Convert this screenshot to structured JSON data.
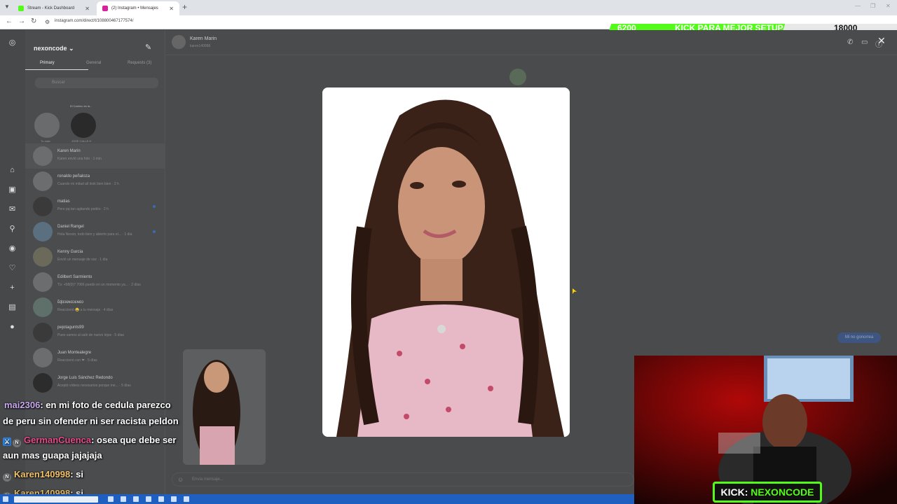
{
  "browser": {
    "tabs": [
      {
        "label": "Stream - Kick Dashboard",
        "favicon_color": "#53fc18"
      },
      {
        "label": "(2) Instagram • Mensajes",
        "favicon_color": "#d6249f"
      }
    ],
    "url": "instagram.com/direct/t/108800467177574/"
  },
  "goal_bar": {
    "current": "6200",
    "title": "KICK PARA MEJOR SETUP",
    "target": "18000",
    "progress_fraction": 0.34
  },
  "instagram": {
    "username": "nexoncode",
    "filter_tabs": [
      "Primary",
      "General",
      "Requests (3)"
    ],
    "search_placeholder": "Buscar",
    "notes": [
      {
        "label": "Tu nota"
      },
      {
        "label": "JOSE CALLE H"
      }
    ],
    "note_text": "El Camino es la...",
    "conversations": [
      {
        "name": "Karen Marin",
        "preview": "Karen envió una foto · 1 min"
      },
      {
        "name": "ronaldo peñaloza",
        "preview": "Cuando mi mitad all look bien bien · 2 h"
      },
      {
        "name": "matias",
        "preview": "Pero pq tan agitando podés · 2 h"
      },
      {
        "name": "Daniel Rangel",
        "preview": "Hola Nexon, todo bien y abierto para el... · 1 día"
      },
      {
        "name": "Kenny Garcia",
        "preview": "Envió un mensaje de voz · 1 día"
      },
      {
        "name": "Edilbert Sarmiento",
        "preview": "Tú: +58(0)7 7066 puedo en un momento ya... · 2 días"
      },
      {
        "name": "ɛ̃ɖɑɔɛɴɑɔɛɴɑɔ",
        "preview": "Reaccionó 😂 a tu mensaje · 4 días"
      },
      {
        "name": "pejotagunts99",
        "preview": "Pues vamos al salir de nuevo lejos · 5 días"
      },
      {
        "name": "Juan Montealegre",
        "preview": "Reaccionó con ❤ · 5 días"
      },
      {
        "name": "Jorge Luis Sánchez Redondo",
        "preview": "Aceptó vídeos necesarios porque me... · 5 días"
      }
    ],
    "chat_header": {
      "name": "Karen Marin",
      "sub": "karen140998"
    },
    "message_bubble": "Mi no gonorrea",
    "message_placeholder": "Envía mensaje..."
  },
  "stream_chat": [
    {
      "user": "mai2306",
      "text": ": en mi foto de cedula parezco",
      "cont": "de peru sin ofender ni ser racista peldon"
    },
    {
      "user": "GermanCuenca",
      "text": ": osea que debe ser",
      "cont": "aun mas guapa jajajaja"
    },
    {
      "user": "Karen140998",
      "text": ": si"
    },
    {
      "user": "Karen140998",
      "text": ": si"
    }
  ],
  "stream_label": {
    "prefix": "KICK:",
    "name": "NEXONCODE"
  },
  "colors": {
    "kick_green": "#53fc18",
    "bg_dim": "#4a4b4d"
  }
}
